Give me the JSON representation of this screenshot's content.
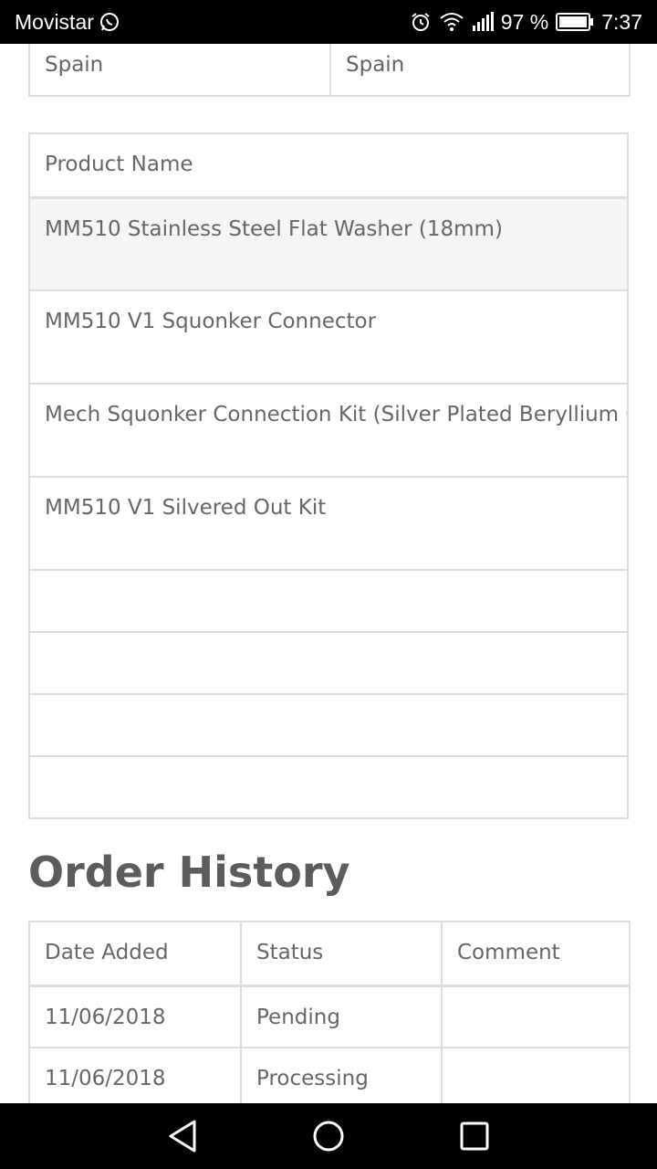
{
  "status_bar": {
    "carrier": "Movistar",
    "battery_percent": "97 %",
    "time": "7:37",
    "icons": [
      "whatsapp-icon",
      "alarm-icon",
      "wifi-icon",
      "signal-icon",
      "battery-icon"
    ]
  },
  "address_table": {
    "row": [
      "Spain",
      "Spain"
    ]
  },
  "products_table": {
    "header": "Product Name",
    "rows": [
      "MM510 Stainless Steel Flat Washer (18mm)",
      "MM510 V1 Squonker Connector",
      "Mech Squonker Connection Kit (Silver Plated Beryllium Co",
      "MM510 V1 Silvered Out Kit"
    ],
    "empty_rows": 4
  },
  "order_history": {
    "title": "Order History",
    "headers": [
      "Date Added",
      "Status",
      "Comment"
    ],
    "rows": [
      {
        "date": "11/06/2018",
        "status": "Pending",
        "comment": ""
      },
      {
        "date": "11/06/2018",
        "status": "Processing",
        "comment": ""
      }
    ]
  },
  "nav_bar": {
    "buttons": [
      "back-icon",
      "home-icon",
      "recents-icon"
    ]
  }
}
